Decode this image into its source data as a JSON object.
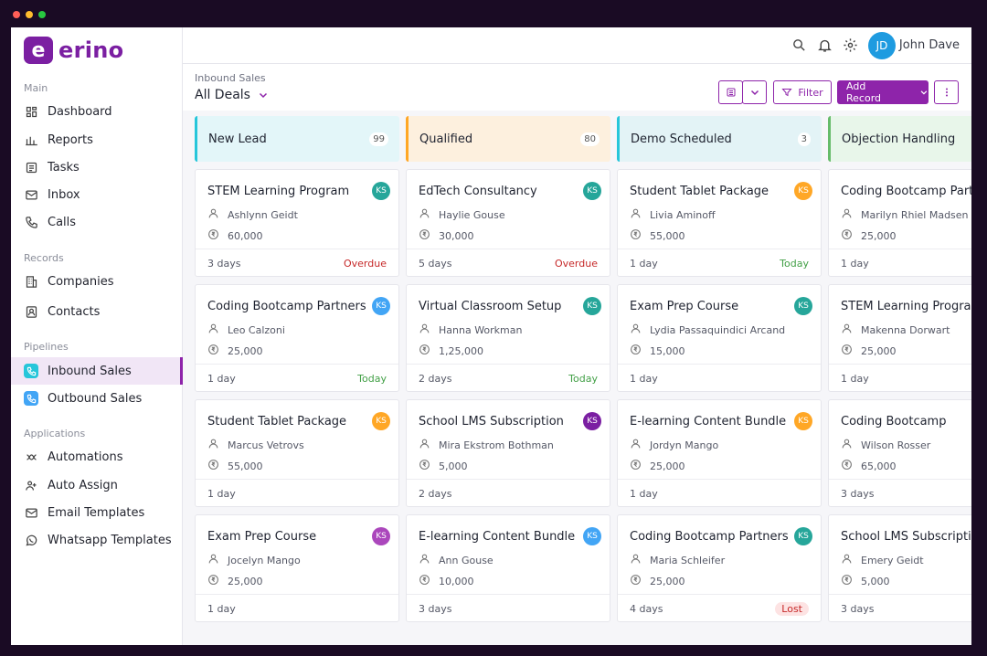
{
  "brand": {
    "name": "erino",
    "mark": "e"
  },
  "sidebar": {
    "sections": [
      {
        "title": "Main",
        "items": [
          {
            "label": "Dashboard",
            "icon": "dashboard-icon"
          },
          {
            "label": "Reports",
            "icon": "reports-icon"
          },
          {
            "label": "Tasks",
            "icon": "tasks-icon"
          },
          {
            "label": "Inbox",
            "icon": "inbox-icon"
          },
          {
            "label": "Calls",
            "icon": "phone-icon"
          }
        ]
      },
      {
        "title": "Records",
        "items": [
          {
            "label": "Companies",
            "icon": "building-icon"
          },
          {
            "label": "Contacts",
            "icon": "contacts-icon"
          }
        ]
      },
      {
        "title": "Pipelines",
        "items": [
          {
            "label": "Inbound Sales",
            "icon": "inbound-call-icon",
            "active": true
          },
          {
            "label": "Outbound Sales",
            "icon": "outbound-call-icon"
          }
        ]
      },
      {
        "title": "Applications",
        "items": [
          {
            "label": "Automations",
            "icon": "automation-icon"
          },
          {
            "label": "Auto Assign",
            "icon": "auto-assign-icon"
          },
          {
            "label": "Email Templates",
            "icon": "email-template-icon"
          },
          {
            "label": "Whatsapp Templates",
            "icon": "whatsapp-icon"
          }
        ]
      }
    ]
  },
  "header": {
    "user_initials": "JD",
    "user_name": "John Dave"
  },
  "toolbar": {
    "breadcrumb": "Inbound Sales",
    "view": "All Deals",
    "filter_label": "Filter",
    "add_label": "Add Record"
  },
  "colors": {
    "accent": "#8e24aa",
    "overdue": "#c62828",
    "today": "#43a047"
  },
  "columns": [
    {
      "title": "New Lead",
      "count": "99",
      "bg": "#e3f6f9",
      "border": "#26c6da",
      "cards": [
        {
          "title": "STEM Learning Program",
          "owner": "Ashlynn Geidt",
          "amount": "60,000",
          "age": "3 days",
          "status": "Overdue",
          "status_type": "overdue",
          "badge": "KS",
          "badge_color": "#26a69a"
        },
        {
          "title": "Coding Bootcamp Partners",
          "owner": "Leo Calzoni",
          "amount": "25,000",
          "age": "1 day",
          "status": "Today",
          "status_type": "today",
          "badge": "KS",
          "badge_color": "#42a5f5"
        },
        {
          "title": "Student Tablet Package",
          "owner": "Marcus Vetrovs",
          "amount": "55,000",
          "age": "1 day",
          "status": "",
          "status_type": "",
          "badge": "KS",
          "badge_color": "#ffa726"
        },
        {
          "title": "Exam Prep Course",
          "owner": "Jocelyn Mango",
          "amount": "25,000",
          "age": "1 day",
          "status": "",
          "status_type": "",
          "badge": "KS",
          "badge_color": "#ab47bc"
        }
      ]
    },
    {
      "title": "Qualified",
      "count": "80",
      "bg": "#fdf0de",
      "border": "#ffa726",
      "cards": [
        {
          "title": "EdTech Consultancy",
          "owner": "Haylie Gouse",
          "amount": "30,000",
          "age": "5 days",
          "status": "Overdue",
          "status_type": "overdue",
          "badge": "KS",
          "badge_color": "#26a69a"
        },
        {
          "title": "Virtual Classroom Setup",
          "owner": "Hanna Workman",
          "amount": "1,25,000",
          "age": "2 days",
          "status": "Today",
          "status_type": "today",
          "badge": "KS",
          "badge_color": "#26a69a"
        },
        {
          "title": "School LMS Subscription",
          "owner": "Mira Ekstrom Bothman",
          "amount": "5,000",
          "age": "2 days",
          "status": "",
          "status_type": "",
          "badge": "KS",
          "badge_color": "#7b1fa2"
        },
        {
          "title": "E-learning Content Bundle",
          "owner": "Ann Gouse",
          "amount": "10,000",
          "age": "3 days",
          "status": "",
          "status_type": "",
          "badge": "KS",
          "badge_color": "#42a5f5"
        }
      ]
    },
    {
      "title": "Demo Scheduled",
      "count": "3",
      "bg": "#e3f3f6",
      "border": "#26c6da",
      "cards": [
        {
          "title": "Student Tablet Package",
          "owner": "Livia Aminoff",
          "amount": "55,000",
          "age": "1 day",
          "status": "Today",
          "status_type": "today",
          "badge": "KS",
          "badge_color": "#ffa726"
        },
        {
          "title": "Exam Prep Course",
          "owner": "Lydia Passaquindici Arcand",
          "amount": "15,000",
          "age": "1 day",
          "status": "",
          "status_type": "",
          "badge": "KS",
          "badge_color": "#26a69a"
        },
        {
          "title": "E-learning Content Bundle",
          "owner": "Jordyn Mango",
          "amount": "25,000",
          "age": "1 day",
          "status": "",
          "status_type": "",
          "badge": "KS",
          "badge_color": "#ffa726"
        },
        {
          "title": "Coding Bootcamp Partners",
          "owner": "Maria Schleifer",
          "amount": "25,000",
          "age": "4 days",
          "status": "Lost",
          "status_type": "lost",
          "badge": "KS",
          "badge_color": "#26a69a"
        }
      ]
    },
    {
      "title": "Objection Handling",
      "count": "",
      "bg": "#e8f6ea",
      "border": "#66bb6a",
      "cards": [
        {
          "title": "Coding Bootcamp Partners",
          "owner": "Marilyn Rhiel Madsen",
          "amount": "25,000",
          "age": "1 day",
          "status": "",
          "status_type": "",
          "badge": "",
          "badge_color": ""
        },
        {
          "title": "STEM Learning Program",
          "owner": "Makenna Dorwart",
          "amount": "25,000",
          "age": "1 day",
          "status": "",
          "status_type": "",
          "badge": "",
          "badge_color": ""
        },
        {
          "title": "Coding Bootcamp",
          "owner": "Wilson Rosser",
          "amount": "65,000",
          "age": "3 days",
          "status": "",
          "status_type": "",
          "badge": "",
          "badge_color": ""
        },
        {
          "title": "School LMS Subscription",
          "owner": "Emery Geidt",
          "amount": "5,000",
          "age": "3 days",
          "status": "",
          "status_type": "",
          "badge": "",
          "badge_color": ""
        }
      ]
    }
  ]
}
